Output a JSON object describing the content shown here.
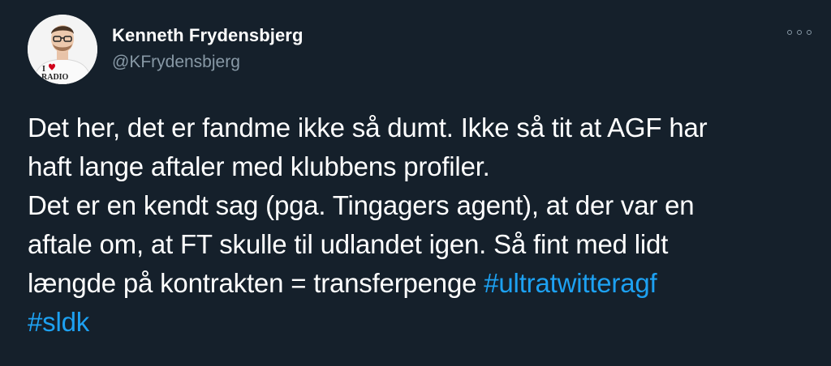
{
  "author": {
    "display_name": "Kenneth Frydensbjerg",
    "handle": "@KFrydensbjerg",
    "avatar_shirt_text_top": "I",
    "avatar_shirt_text_bottom": "RADIO"
  },
  "more_button": {
    "icon": "more-options-icon"
  },
  "tweet": {
    "line_1": "Det her, det er fandme ikke så dumt. Ikke så tit at AGF har",
    "line_2": "haft lange aftaler med klubbens profiler.",
    "line_3": "Det er en kendt sag (pga. Tingagers agent), at der var en",
    "line_4": "aftale om, at FT skulle til udlandet igen. Så fint med lidt",
    "line_5_text": "længde på kontrakten = transferpenge ",
    "hashtag_1": "#ultratwitteragf",
    "hashtag_2": "#sldk"
  },
  "colors": {
    "background": "#15202b",
    "text": "#ffffff",
    "secondary": "#8899a6",
    "link": "#1da1f2"
  }
}
